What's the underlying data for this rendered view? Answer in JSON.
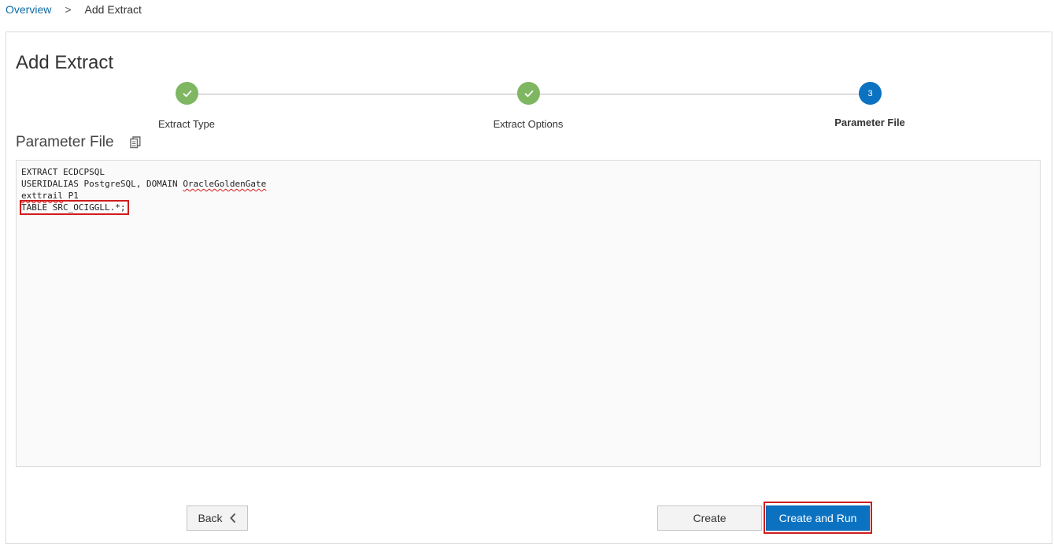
{
  "breadcrumb": {
    "items": [
      "Overview",
      "Add Extract"
    ],
    "separator": ">"
  },
  "page": {
    "title": "Add Extract"
  },
  "stepper": {
    "steps": [
      {
        "label": "Extract Type",
        "state": "complete",
        "icon": "check-icon"
      },
      {
        "label": "Extract Options",
        "state": "complete",
        "icon": "check-icon"
      },
      {
        "label": "Parameter File",
        "state": "active",
        "number": "3"
      }
    ],
    "colors": {
      "complete": "#7eb662",
      "active": "#0b72c1"
    }
  },
  "section": {
    "title": "Parameter File",
    "icon": "copy-icon"
  },
  "editor": {
    "line1": "EXTRACT ECDCPSQL",
    "line2_prefix": "USERIDALIAS PostgreSQL, DOMAIN ",
    "line2_squiggle": "OracleGoldenGate",
    "line3_squiggle": "exttrail",
    "line3_suffix": " P1",
    "line4": "TABLE SRC_OCIGGLL.*;"
  },
  "buttons": {
    "back": "Back",
    "create": "Create",
    "create_and_run": "Create and Run"
  }
}
